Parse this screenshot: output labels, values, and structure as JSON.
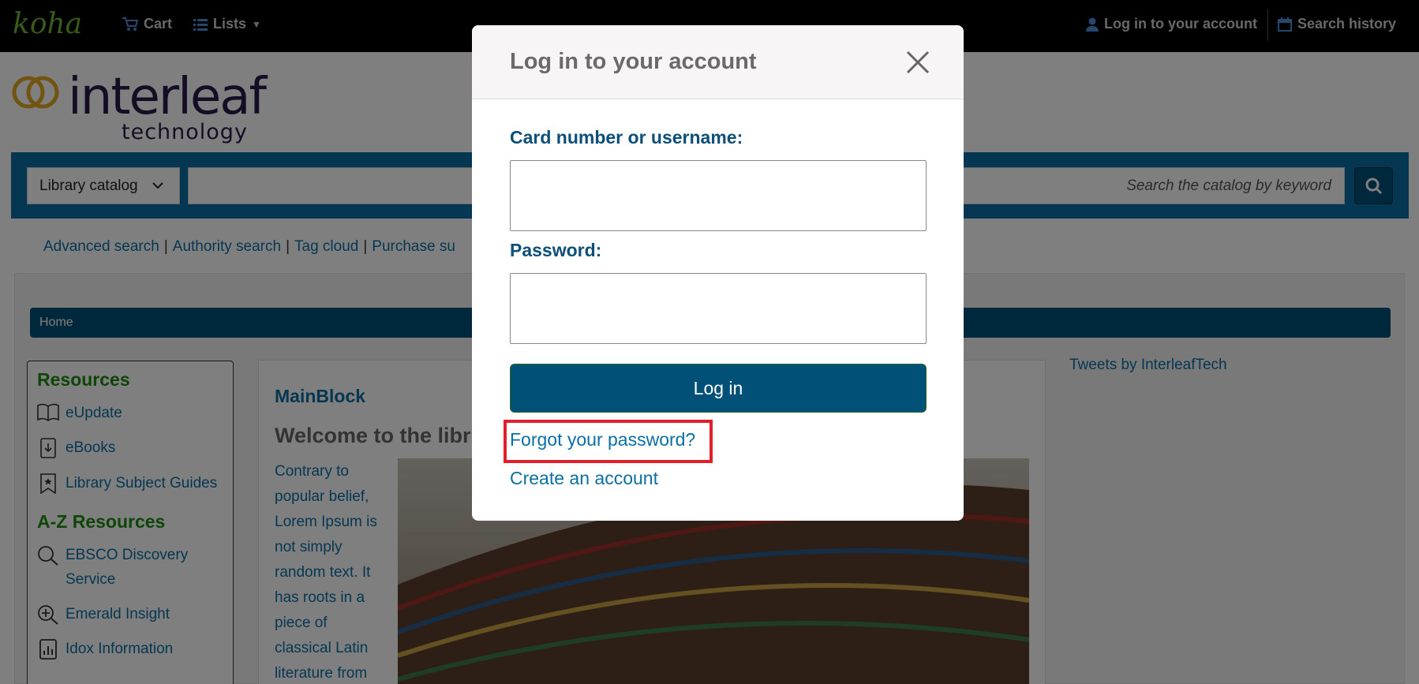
{
  "navbar": {
    "logo": "koha",
    "cart": "Cart",
    "lists": "Lists",
    "login": "Log in to your account",
    "search_history": "Search history"
  },
  "brand": {
    "name": "interleaf",
    "tagline": "technology"
  },
  "search": {
    "catalog_selected": "Library catalog",
    "placeholder": "Search the catalog by keyword"
  },
  "quicklinks": [
    "Advanced search",
    "Authority search",
    "Tag cloud",
    "Purchase su"
  ],
  "breadcrumb": "Home",
  "left_nav": {
    "resources_title": "Resources",
    "resources": [
      "eUpdate",
      "eBooks",
      "Library Subject Guides"
    ],
    "az_title": "A-Z Resources",
    "az": [
      "EBSCO Discovery Service",
      "Emerald Insight",
      "Idox Information"
    ]
  },
  "main": {
    "block_title": "MainBlock",
    "welcome": "Welcome to the libr",
    "lorem": "Contrary to popular belief, Lorem Ipsum is not simply random text. It has roots in a piece of classical Latin literature from"
  },
  "tweets": "Tweets by InterleafTech",
  "modal": {
    "title": "Log in to your account",
    "username_label": "Card number or username:",
    "password_label": "Password:",
    "login_button": "Log in",
    "forgot": "Forgot your password?",
    "create": "Create an account"
  }
}
